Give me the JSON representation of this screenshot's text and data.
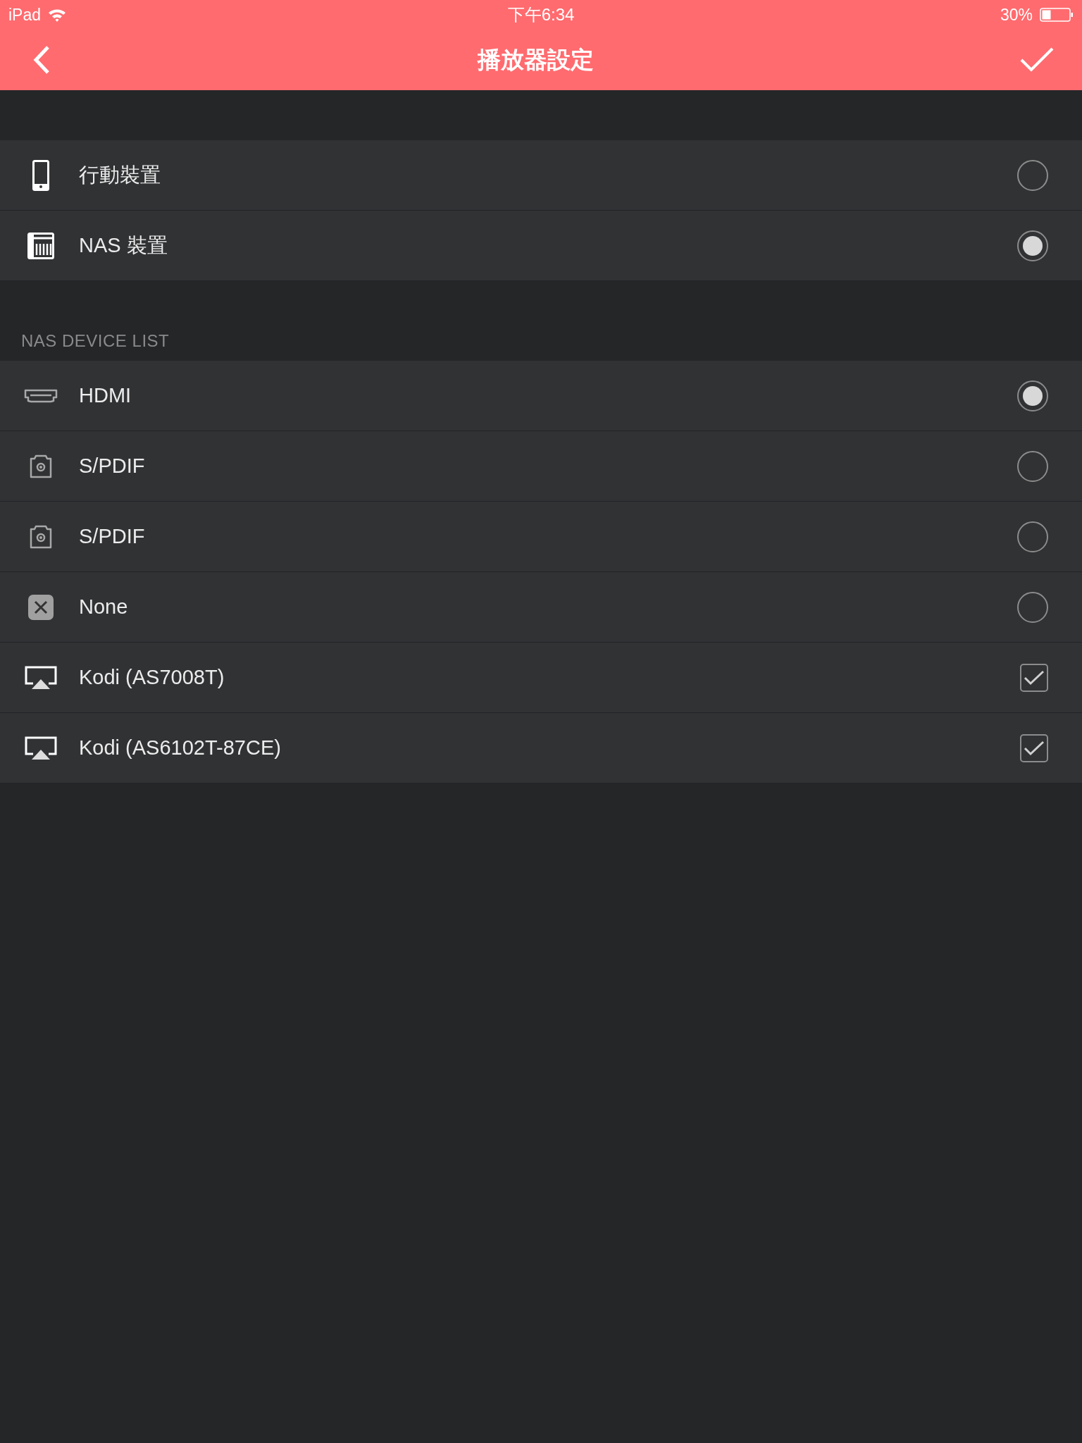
{
  "status_bar": {
    "device": "iPad",
    "time": "下午6:34",
    "battery": "30%"
  },
  "nav_bar": {
    "title": "播放器設定"
  },
  "player_types": [
    {
      "label": "行動裝置",
      "kind": "phone",
      "selected": false
    },
    {
      "label": "NAS 裝置",
      "kind": "nas",
      "selected": true
    }
  ],
  "nas_device_list": {
    "header": "NAS DEVICE LIST",
    "items": [
      {
        "label": "HDMI",
        "kind": "hdmi",
        "selected": true
      },
      {
        "label": "S/PDIF",
        "kind": "optical",
        "selected": false
      },
      {
        "label": "S/PDIF",
        "kind": "optical",
        "selected": false
      },
      {
        "label": "None",
        "kind": "none",
        "selected": false
      },
      {
        "label": "Kodi (AS7008T)",
        "kind": "airplay",
        "checked": true
      },
      {
        "label": "Kodi (AS6102T-87CE)",
        "kind": "airplay",
        "checked": true
      }
    ]
  }
}
